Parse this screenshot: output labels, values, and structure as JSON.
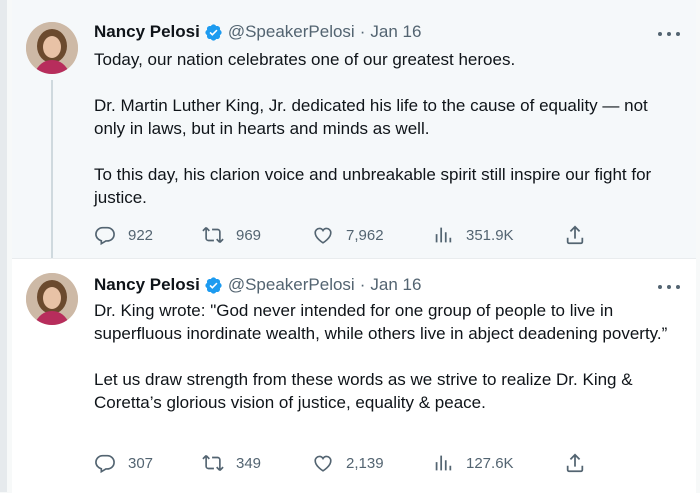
{
  "tweets": [
    {
      "author": "Nancy Pelosi",
      "handle": "@SpeakerPelosi",
      "separator": "·",
      "date": "Jan 16",
      "paragraphs": [
        "Today, our nation celebrates one of our greatest heroes.",
        "Dr. Martin Luther King, Jr. dedicated his life to the cause of equality — not only in laws, but in hearts and minds as well.",
        "To this day, his clarion voice and unbreakable spirit still inspire our fight for justice."
      ],
      "replies": "922",
      "retweets": "969",
      "likes": "7,962",
      "views": "351.9K"
    },
    {
      "author": "Nancy Pelosi",
      "handle": "@SpeakerPelosi",
      "separator": "·",
      "date": "Jan 16",
      "paragraphs": [
        "Dr. King wrote: \"God never intended for one group of people to live in superfluous inordinate wealth, while others live in abject deadening poverty.”",
        "Let us draw strength from these words as we strive to realize Dr. King & Coretta’s glorious vision of justice, equality & peace."
      ],
      "replies": "307",
      "retweets": "349",
      "likes": "2,139",
      "views": "127.6K"
    }
  ],
  "colors": {
    "verified": "#1d9bf0",
    "muted": "#536471",
    "text": "#0f1419"
  },
  "icons": [
    "verified-badge-icon",
    "more-icon",
    "reply-icon",
    "retweet-icon",
    "like-icon",
    "views-icon",
    "share-icon"
  ]
}
